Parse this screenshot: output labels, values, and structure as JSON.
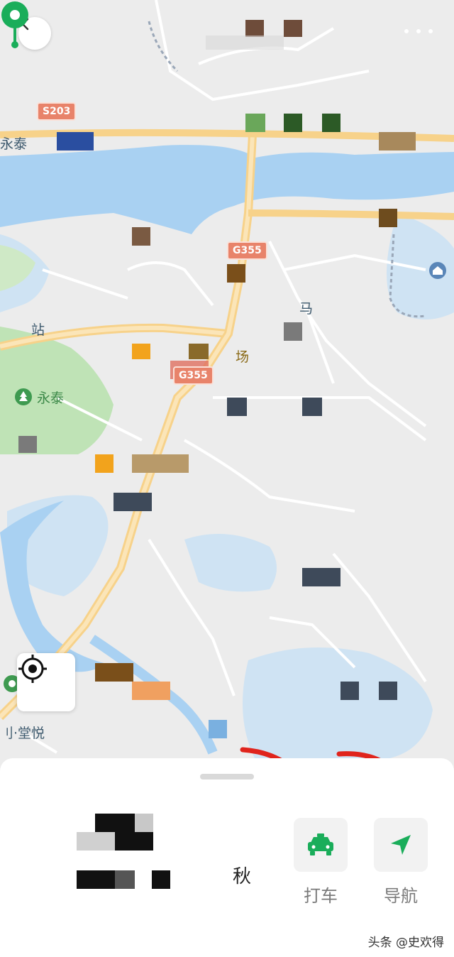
{
  "header": {
    "back_icon": "chevron-left-icon",
    "more_icon": "more-dots-icon"
  },
  "map": {
    "road_shields": [
      "S203",
      "G355",
      "G355"
    ],
    "labels": {
      "left_top": "永泰",
      "station": "站",
      "poi_park": "永泰",
      "poi_field": "场",
      "road_side": "马",
      "bottom_left": "刂·堂悦"
    },
    "colors": {
      "water": "#a9d1f2",
      "park": "#bfe3b6",
      "road_major": "#f7d28a",
      "pin": "#1aad5a"
    }
  },
  "sheet": {
    "taxi_label": "打车",
    "navigate_label": "导航",
    "partial_text": "秋",
    "taxi_icon": "taxi-icon",
    "navigate_icon": "navigate-arrow-icon"
  },
  "annotation": {
    "arrow_color": "#e0241c"
  },
  "watermark": "头条 @史欢得"
}
